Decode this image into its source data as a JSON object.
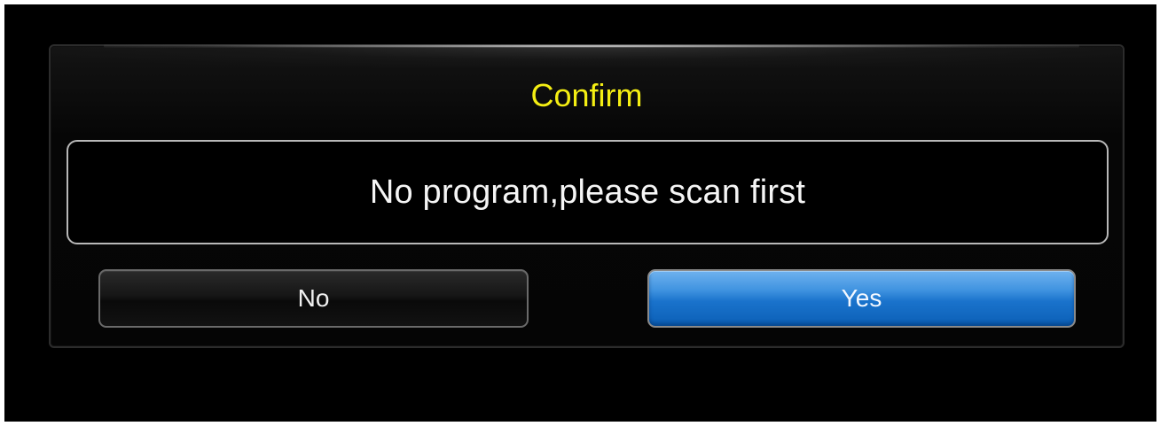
{
  "dialog": {
    "title": "Confirm",
    "message": "No program,please scan first",
    "no_label": "No",
    "yes_label": "Yes"
  },
  "colors": {
    "title": "#f4ee13",
    "yes_button": "#1a73cc",
    "background": "#000000"
  }
}
